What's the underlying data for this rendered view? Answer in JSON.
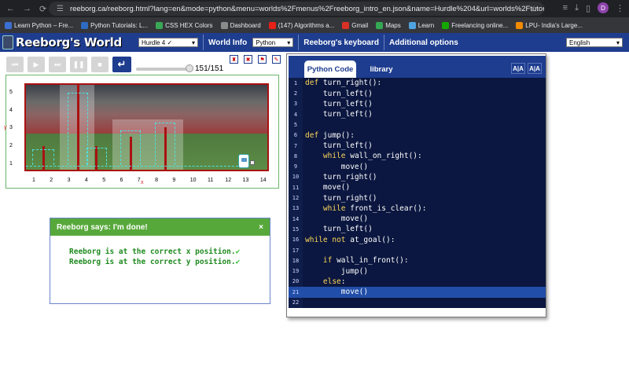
{
  "browser": {
    "url": "reeborg.ca/reeborg.html?lang=en&mode=python&menu=worlds%2Fmenus%2Freeborg_intro_en.json&name=Hurdle%204&url=worlds%2Ftutorial_en%2Fhur...",
    "avatar_letter": "D",
    "bookmarks": [
      {
        "label": "Learn Python – Fre...",
        "color": "#3b6fd1"
      },
      {
        "label": "Python Tutorials: L...",
        "color": "#2d6cc0"
      },
      {
        "label": "CSS HEX Colors",
        "color": "#3aa757"
      },
      {
        "label": "Dashboard",
        "color": "#8a8a8a"
      },
      {
        "label": "(147) Algorithms a...",
        "color": "#e62117"
      },
      {
        "label": "Gmail",
        "color": "#d93025"
      },
      {
        "label": "Maps",
        "color": "#34a853"
      },
      {
        "label": "Learn",
        "color": "#4fa3e0"
      },
      {
        "label": "Freelancing online...",
        "color": "#14a800"
      },
      {
        "label": "LPU- India's Large...",
        "color": "#f28b00"
      }
    ]
  },
  "header": {
    "logo_text": "Reeborg's World",
    "world_select": "Hurdle 4 ✓",
    "world_info_label": "World Info",
    "language_select": "Python",
    "keyboard_label": "Reeborg's keyboard",
    "options_label": "Additional options",
    "ui_language_select": "English"
  },
  "controls": {
    "step_count": "151/151",
    "slider_progress": 1.0
  },
  "world": {
    "y_label": "y",
    "x_label": "x",
    "rows": [
      "5",
      "4",
      "3",
      "2",
      "1"
    ],
    "cols": [
      "1",
      "2",
      "3",
      "4",
      "5",
      "6",
      "7",
      "8",
      "9",
      "10",
      "11",
      "12",
      "13",
      "14"
    ]
  },
  "dialog": {
    "title": "Reeborg says: I'm done!",
    "close": "×",
    "line1": "Reeborg is at the correct x position.",
    "line2": "Reeborg is at the correct y position.",
    "check": "✔"
  },
  "editor": {
    "tab_code": "Python Code",
    "tab_library": "library",
    "font_smaller": "A|A",
    "font_larger": "A|A",
    "current_line": 21,
    "lines": [
      "def turn_right():",
      "    turn_left()",
      "    turn_left()",
      "    turn_left()",
      "",
      "def jump():",
      "    turn_left()",
      "    while wall_on_right():",
      "        move()",
      "    turn_right()",
      "    move()",
      "    turn_right()",
      "    while front_is_clear():",
      "        move()",
      "    turn_left()",
      "while not at_goal():",
      "",
      "    if wall_in_front():",
      "        jump()",
      "    else:",
      "        move()",
      ""
    ]
  }
}
